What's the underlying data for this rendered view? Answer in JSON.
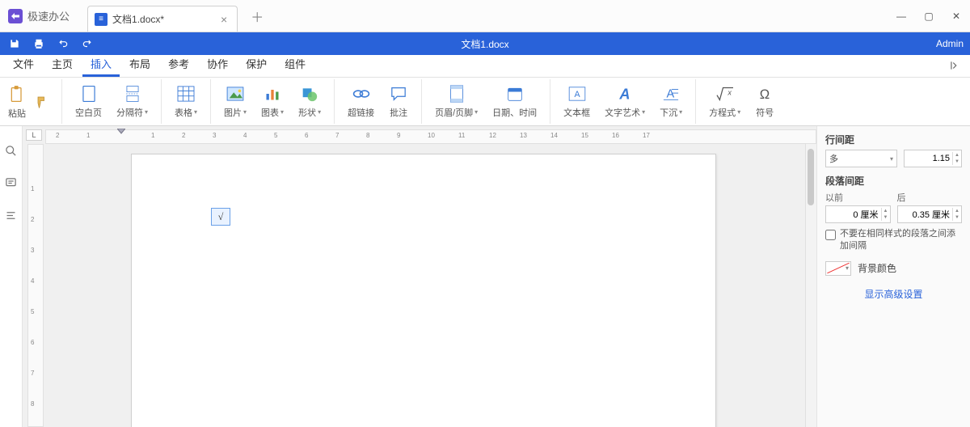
{
  "app": {
    "name": "极速办公"
  },
  "tab": {
    "title": "文档1.docx*"
  },
  "document_title": "文档1.docx",
  "user": "Admin",
  "ribbon_tabs": [
    "文件",
    "主页",
    "插入",
    "布局",
    "参考",
    "协作",
    "保护",
    "组件"
  ],
  "ribbon_active_index": 2,
  "clipboard": {
    "paste": "粘贴"
  },
  "ribbon": {
    "blank_page": "空白页",
    "page_break": "分隔符",
    "table": "表格",
    "picture": "图片",
    "chart": "图表",
    "shape": "形状",
    "hyperlink": "超链接",
    "comment": "批注",
    "header_footer": "页眉/页脚",
    "date_time": "日期、时间",
    "textbox": "文本框",
    "wordart": "文字艺术",
    "dropcap": "下沉",
    "equation": "方程式",
    "symbol": "符号"
  },
  "canvas": {
    "equation_placeholder": "√"
  },
  "panel": {
    "line_spacing_label": "行间距",
    "line_spacing_type": "多",
    "line_spacing_value": "1.15",
    "para_spacing_label": "段落间距",
    "before_label": "以前",
    "after_label": "后",
    "before_value": "0 厘米",
    "after_value": "0.35 厘米",
    "no_space_checkbox": "不要在相同样式的段落之间添加间隔",
    "bgcolor_label": "背景颜色",
    "advanced": "显示高级设置"
  }
}
